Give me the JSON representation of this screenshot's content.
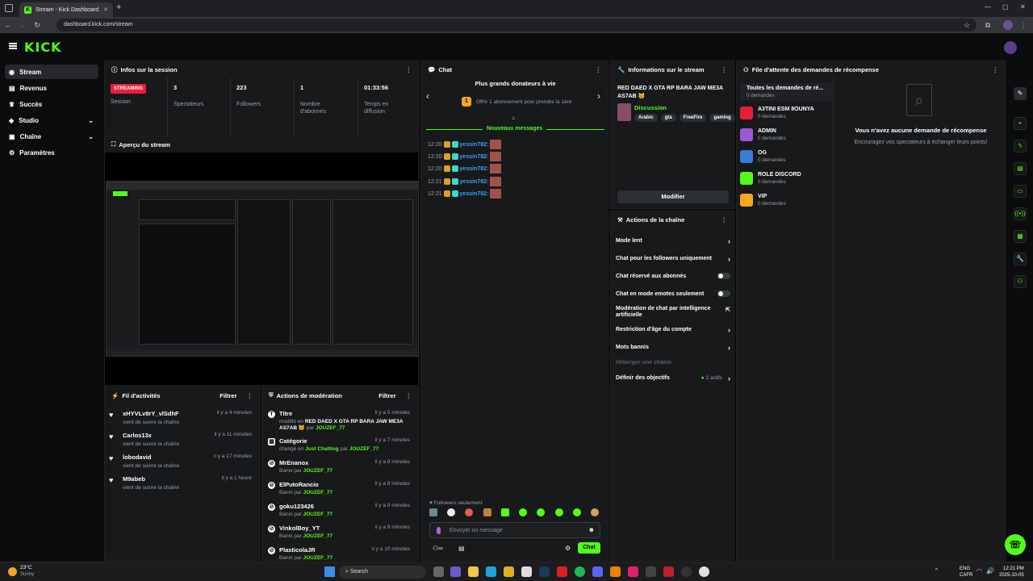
{
  "browser": {
    "tab_title": "Stream - Kick Dashboard",
    "url": "dashboard.kick.com/stream"
  },
  "header": {
    "logo": "KICK"
  },
  "sidebar": {
    "items": [
      {
        "label": "Stream"
      },
      {
        "label": "Revenus"
      },
      {
        "label": "Succès"
      },
      {
        "label": "Studio"
      },
      {
        "label": "Chaîne"
      },
      {
        "label": "Paramètres"
      }
    ]
  },
  "session": {
    "title": "Infos sur la session",
    "live_badge": "STREAMING",
    "stats": [
      {
        "value": "",
        "label": "Session"
      },
      {
        "value": "3",
        "label": "Spectateurs"
      },
      {
        "value": "223",
        "label": "Followers"
      },
      {
        "value": "1",
        "label": "Nombre d'abonnés"
      },
      {
        "value": "01:33:56",
        "label": "Temps en diffusion"
      }
    ]
  },
  "preview": {
    "title": "Aperçu du stream"
  },
  "activity": {
    "title": "Fil d'activités",
    "filter": "Filtrer",
    "rows": [
      {
        "name": "xHYVLv8rY_vlSdhF",
        "sub": "vient de suivre la chaîne",
        "time": "il y a 4 minutes"
      },
      {
        "name": "Carlos13x",
        "sub": "vient de suivre la chaîne",
        "time": "il y a 11 minutes"
      },
      {
        "name": "lobodavid",
        "sub": "vient de suivre la chaîne",
        "time": "il y a 17 minutes"
      },
      {
        "name": "M9abeb",
        "sub": "vient de suivre la chaîne",
        "time": "il y a 1 heure"
      }
    ]
  },
  "moderation": {
    "title": "Actions de modération",
    "filter": "Filtrer",
    "rows": [
      {
        "name": "Titre",
        "sub1": "modifié en",
        "hl": "RED DAED X GTA RP BARA JAW ME3A AS7AB 🐱",
        "sub2": "par",
        "user": "JOUZEF_77",
        "time": "il y a 5 minutes"
      },
      {
        "name": "Catégorie",
        "sub1": "changé en",
        "hl": "Just Chatting",
        "sub2": "par",
        "user": "JOUZEF_77",
        "time": "il y a 7 minutes"
      },
      {
        "name": "MrEnanox",
        "sub1": "Banni par",
        "hl": "",
        "sub2": "",
        "user": "JOUZEF_77",
        "time": "il y a 9 minutes"
      },
      {
        "name": "ElPutoRancio",
        "sub1": "Banni par",
        "hl": "",
        "sub2": "",
        "user": "JOUZEF_77",
        "time": "il y a 9 minutes"
      },
      {
        "name": "goku123426",
        "sub1": "Banni par",
        "hl": "",
        "sub2": "",
        "user": "JOUZEF_77",
        "time": "il y a 9 minutes"
      },
      {
        "name": "VinkolBoy_YT",
        "sub1": "Banni par",
        "hl": "",
        "sub2": "",
        "user": "JOUZEF_77",
        "time": "il y a 9 minutes"
      },
      {
        "name": "PlasticolaJR",
        "sub1": "Banni par",
        "hl": "",
        "sub2": "",
        "user": "JOUZEF_77",
        "time": "il y a 10 minutes"
      }
    ]
  },
  "chat": {
    "title": "Chat",
    "donors_title": "Plus grands donateurs à vie",
    "donor_rank": "1",
    "donor_text": "Offrir 1 abonnement pour prendre la 1ère",
    "new_messages": "Nouveaux messages",
    "messages": [
      {
        "time": "12:20",
        "user": "yessin782:"
      },
      {
        "time": "12:20",
        "user": "yessin782:"
      },
      {
        "time": "12:20",
        "user": "yessin782:"
      },
      {
        "time": "12:21",
        "user": "yessin782:"
      },
      {
        "time": "12:21",
        "user": "yessin782:"
      }
    ],
    "followers_only": "Followers seulement",
    "input_placeholder": "Envoyer un message",
    "send_label": "Chat"
  },
  "stream_info": {
    "title": "Informations sur le stream",
    "stream_title": "RED DAED X GTA RP BARA JAW ME3A AS7AB 🐱",
    "category": "Discussion",
    "tags": [
      "Arabic",
      "gta",
      "FreeFire",
      "gaming"
    ],
    "edit_label": "Modifier"
  },
  "channel_actions": {
    "title": "Actions de la chaîne",
    "items": [
      {
        "label": "Mode lent"
      },
      {
        "label": "Chat pour les followers uniquement"
      },
      {
        "label": "Chat réservé aux abonnés"
      },
      {
        "label": "Chat en mode emotes seulement"
      },
      {
        "label": "Modération de chat par intelligence artificielle"
      },
      {
        "label": "Restriction d'âge du compte"
      },
      {
        "label": "Mots bannis"
      },
      {
        "label": "Héberger une chaîne"
      },
      {
        "label": "Définir des objectifs"
      }
    ],
    "goals_count": "2 actifs"
  },
  "rewards": {
    "title": "File d'attente des demandes de récompense",
    "list": [
      {
        "name": "Toutes les demandes de ré...",
        "count": "0 demandes"
      },
      {
        "name": "A3TINI ESM 8OUNYA",
        "count": "0 demandes",
        "color": "#e91e3b"
      },
      {
        "name": "ADMIN",
        "count": "0 demandes",
        "color": "#9b59d9"
      },
      {
        "name": "OG",
        "count": "0 demandes",
        "color": "#3a7bd5"
      },
      {
        "name": "ROLE DISCORD",
        "count": "0 demandes",
        "color": "#53fc18"
      },
      {
        "name": "VIP",
        "count": "0 demandes",
        "color": "#f5a623"
      }
    ],
    "empty_title": "Vous n'avez aucune demande de récompense",
    "empty_sub": "Encouragez vos spectateurs à échanger leurs points!"
  },
  "taskbar": {
    "weather_temp": "23°C",
    "weather_desc": "Sunny",
    "search": "Search",
    "lang1": "ENG",
    "lang2": "CAFR",
    "time": "12:21 PM",
    "date": "2025-10-05"
  }
}
